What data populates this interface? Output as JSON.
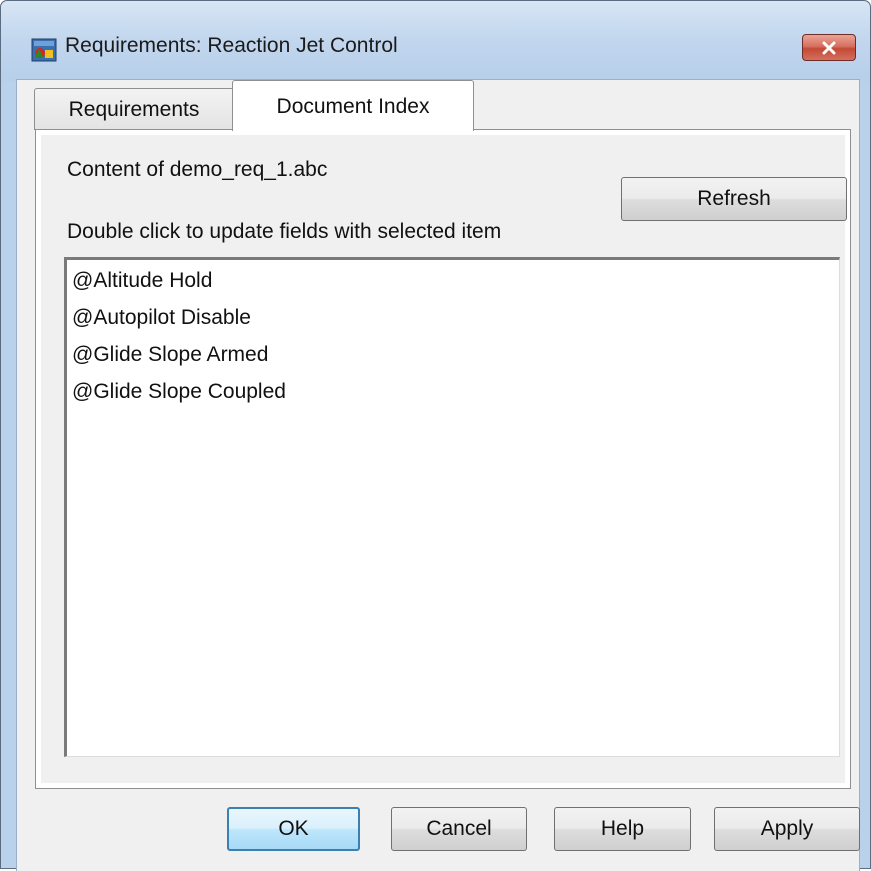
{
  "window": {
    "title": "Requirements: Reaction Jet Control",
    "icon": "simulink-model-icon",
    "close_icon": "close-icon"
  },
  "tabs": [
    {
      "label": "Requirements",
      "active": false
    },
    {
      "label": "Document Index",
      "active": true
    }
  ],
  "document_index": {
    "content_label": "Content of demo_req_1.abc",
    "instruction": "Double click to update fields with selected item",
    "refresh_label": "Refresh",
    "items": [
      "@Altitude Hold",
      "@Autopilot Disable",
      "@Glide Slope Armed",
      "@Glide Slope Coupled"
    ]
  },
  "buttons": {
    "ok": "OK",
    "cancel": "Cancel",
    "help": "Help",
    "apply": "Apply"
  },
  "colors": {
    "titlebar": "#c3d7ee",
    "close_button": "#c34a36",
    "default_button_border": "#3c7fb1"
  }
}
